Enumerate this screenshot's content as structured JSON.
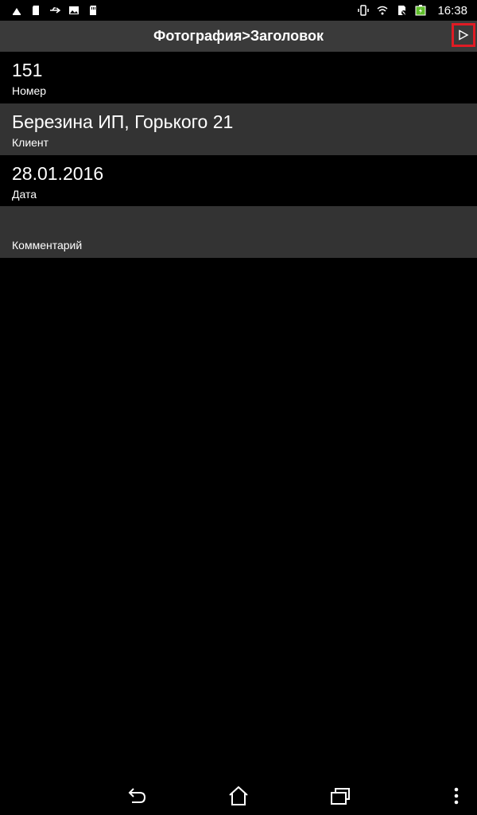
{
  "status_bar": {
    "time": "16:38",
    "left_icons": [
      "upload-icon",
      "sd-card-icon",
      "usb-icon",
      "image-icon",
      "sd-storage-icon"
    ],
    "right_icons": [
      "vibrate-icon",
      "wifi-icon",
      "no-sim-icon",
      "battery-charging-icon"
    ]
  },
  "header": {
    "title": "Фотография>Заголовок",
    "next_icon": "play-outline-icon"
  },
  "fields": [
    {
      "value": "151",
      "label": "Номер"
    },
    {
      "value": "Березина ИП, Горького 21",
      "label": "Клиент"
    },
    {
      "value": "28.01.2016",
      "label": "Дата"
    },
    {
      "value": "",
      "label": "Комментарий"
    }
  ],
  "nav_bar": {
    "icons": [
      "back-icon",
      "home-icon",
      "recents-icon",
      "menu-icon"
    ]
  }
}
